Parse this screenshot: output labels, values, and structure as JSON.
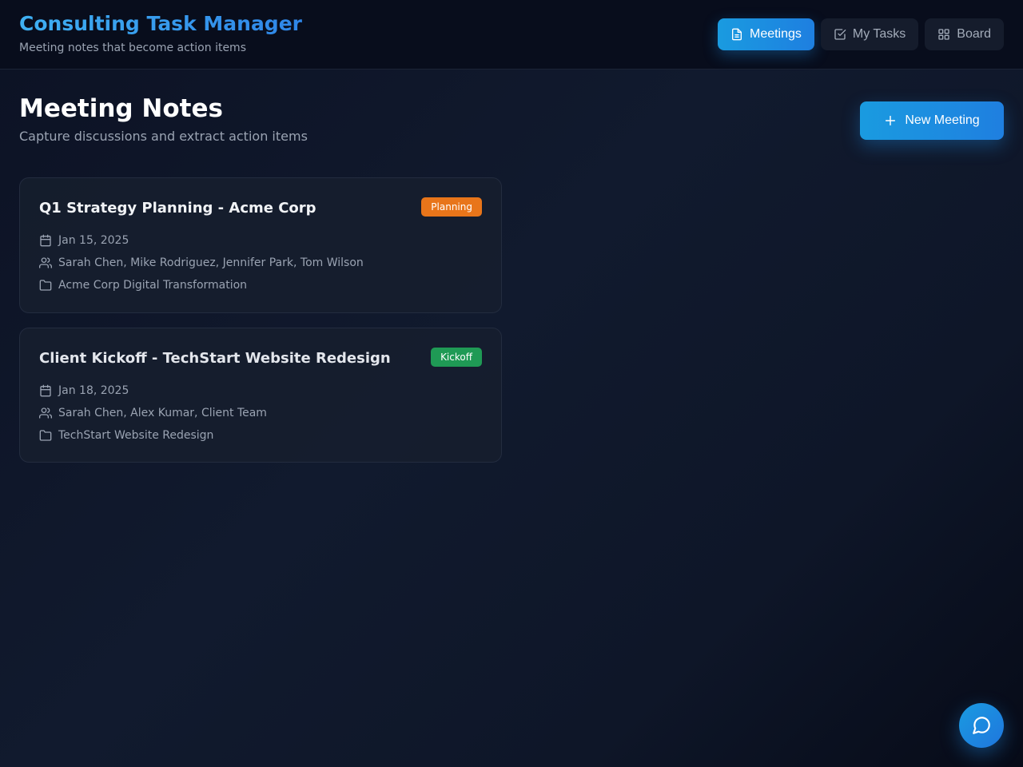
{
  "header": {
    "title": "Consulting Task Manager",
    "subtitle": "Meeting notes that become action items"
  },
  "nav": [
    {
      "label": "Meetings",
      "icon": "document-icon",
      "active": true
    },
    {
      "label": "My Tasks",
      "icon": "checkbox-icon",
      "active": false
    },
    {
      "label": "Board",
      "icon": "grid-icon",
      "active": false
    }
  ],
  "page": {
    "title": "Meeting Notes",
    "subtitle": "Capture discussions and extract action items",
    "new_button_label": "New Meeting"
  },
  "meetings": [
    {
      "title": "Q1 Strategy Planning - Acme Corp",
      "badge": "Planning",
      "badge_color": "#e8751a",
      "date": "Jan 15, 2025",
      "attendees": "Sarah Chen, Mike Rodriguez, Jennifer Park, Tom Wilson",
      "project": "Acme Corp Digital Transformation"
    },
    {
      "title": "Client Kickoff - TechStart Website Redesign",
      "badge": "Kickoff",
      "badge_color": "#1f9a55",
      "date": "Jan 18, 2025",
      "attendees": "Sarah Chen, Alex Kumar, Client Team",
      "project": "TechStart Website Redesign"
    }
  ],
  "colors": {
    "accent": "#1a9be0",
    "title_gradient_start": "#3fb0f2",
    "title_gradient_end": "#2f86e8"
  },
  "icons": {
    "meta": [
      "calendar-icon",
      "users-icon",
      "folder-icon"
    ],
    "new_button": "plus-icon",
    "chat": "chat-bubble-icon"
  }
}
